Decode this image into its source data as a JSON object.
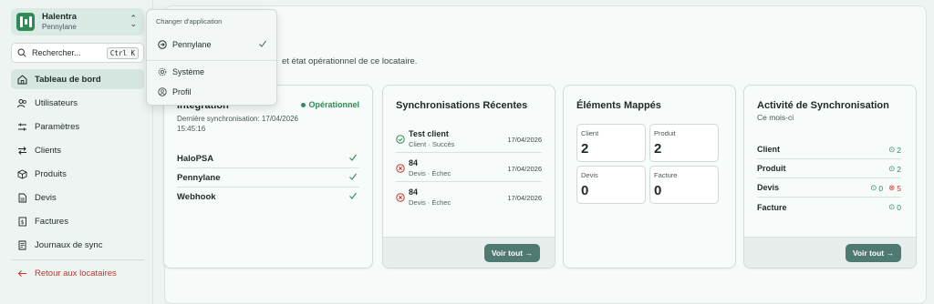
{
  "sidebar": {
    "tenant_name": "Halentra",
    "tenant_sub": "Pennylane",
    "search_label": "Rechercher...",
    "search_shortcut": "Ctrl K",
    "items": [
      {
        "label": "Tableau de bord",
        "icon": "house-icon",
        "active": true
      },
      {
        "label": "Utilisateurs",
        "icon": "users-icon"
      },
      {
        "label": "Paramètres",
        "icon": "sliders-icon"
      },
      {
        "label": "Clients",
        "icon": "swap-icon"
      },
      {
        "label": "Produits",
        "icon": "box-icon"
      },
      {
        "label": "Devis",
        "icon": "document-icon"
      },
      {
        "label": "Factures",
        "icon": "invoice-icon"
      },
      {
        "label": "Journaux de sync",
        "icon": "log-icon"
      }
    ],
    "back_label": "Retour aux locataires"
  },
  "main": {
    "subtitle_visible": "et état opérationnel de ce locataire."
  },
  "integration_card": {
    "title": "Intégration",
    "status": "Opérationnel",
    "last_sync": "Dernière synchronisation: 17/04/2026 15:45:16",
    "rows": [
      "HaloPSA",
      "Pennylane",
      "Webhook"
    ]
  },
  "recent_sync_card": {
    "title": "Synchronisations Récentes",
    "rows": [
      {
        "name": "Test client",
        "sub": "Client · Succès",
        "date": "17/04/2026",
        "status": "success"
      },
      {
        "name": "84",
        "sub": "Devis · Échec",
        "date": "17/04/2026",
        "status": "error"
      },
      {
        "name": "84",
        "sub": "Devis · Échec",
        "date": "17/04/2026",
        "status": "error"
      }
    ],
    "button": "Voir tout →"
  },
  "mapped_card": {
    "title": "Éléments Mappés",
    "tiles": [
      {
        "label": "Client",
        "value": "2"
      },
      {
        "label": "Produit",
        "value": "2"
      },
      {
        "label": "Devis",
        "value": "0"
      },
      {
        "label": "Facture",
        "value": "0"
      }
    ]
  },
  "activity_card": {
    "title": "Activité de Synchronisation",
    "subtitle": "Ce mois-ci",
    "rows": [
      {
        "label": "Client",
        "ok": "2"
      },
      {
        "label": "Produit",
        "ok": "2"
      },
      {
        "label": "Devis",
        "ok": "0",
        "err": "5"
      },
      {
        "label": "Facture",
        "ok": "0"
      }
    ],
    "button": "Voir tout →"
  },
  "app_switcher": {
    "header": "Changer d'application",
    "items": [
      {
        "label": "Pennylane",
        "icon": "pennylane-icon",
        "selected": true
      },
      {
        "label": "Système",
        "icon": "gear-icon"
      },
      {
        "label": "Profil",
        "icon": "user-circle-icon"
      }
    ]
  },
  "colors": {
    "accent": "#2e8b57",
    "button": "#4e7a72",
    "error": "#c0392b"
  }
}
